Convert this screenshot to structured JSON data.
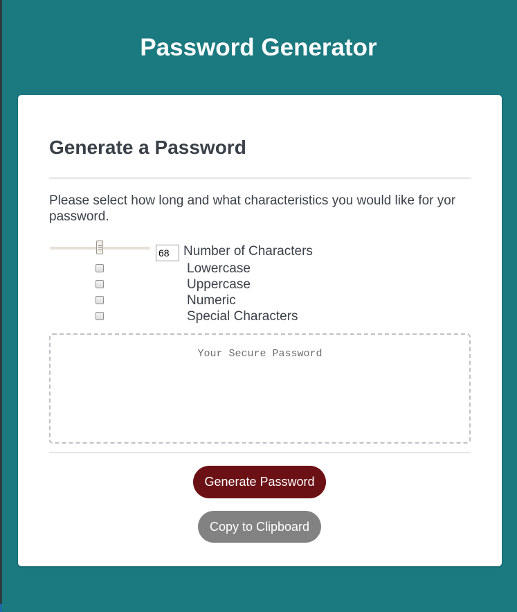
{
  "header": {
    "title": "Password Generator"
  },
  "card": {
    "title": "Generate a Password",
    "instructions": "Please select how long and what characteristics you would like for yor password.",
    "length": {
      "value": "68",
      "label": "Number of Characters"
    },
    "options": [
      {
        "label": "Lowercase",
        "checked": false
      },
      {
        "label": "Uppercase",
        "checked": false
      },
      {
        "label": "Numeric",
        "checked": false
      },
      {
        "label": "Special Characters",
        "checked": false
      }
    ],
    "password": {
      "placeholder": "Your Secure Password",
      "value": ""
    },
    "generate_label": "Generate Password",
    "copy_label": "Copy to Clipboard"
  },
  "colors": {
    "background": "#1b7a80",
    "card": "#ffffff",
    "generate_button": "#6b1115",
    "copy_button": "#828282",
    "text": "#3a4148"
  }
}
